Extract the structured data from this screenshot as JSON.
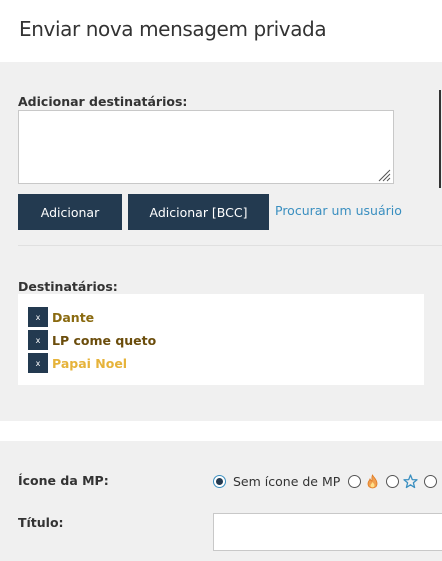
{
  "header": {
    "title": "Enviar nova mensagem privada"
  },
  "add_recipients": {
    "label": "Adicionar destinatários:",
    "textarea_value": "",
    "add_button": "Adicionar",
    "add_bcc_button": "Adicionar [BCC]",
    "search_link": "Procurar um usuário"
  },
  "recipients": {
    "label": "Destinatários:",
    "remove_glyph": "x",
    "items": [
      {
        "name": "Dante",
        "color": "#8a6a10"
      },
      {
        "name": "LP come queto",
        "color": "#6b4d0c"
      },
      {
        "name": "Papai Noel",
        "color": "#e6b33a"
      }
    ]
  },
  "pm_icon": {
    "label": "Ícone da MP:",
    "options": [
      {
        "label": "Sem ícone de MP",
        "checked": true
      },
      {
        "icon": "fire-icon",
        "checked": false
      },
      {
        "icon": "star-icon",
        "checked": false
      },
      {
        "icon": "unknown-icon",
        "checked": false
      }
    ]
  },
  "title_field": {
    "label": "Título:",
    "value": ""
  },
  "colors": {
    "button_bg": "#233a50",
    "link": "#3a8fc0",
    "panel_bg": "#f0f0f0"
  }
}
